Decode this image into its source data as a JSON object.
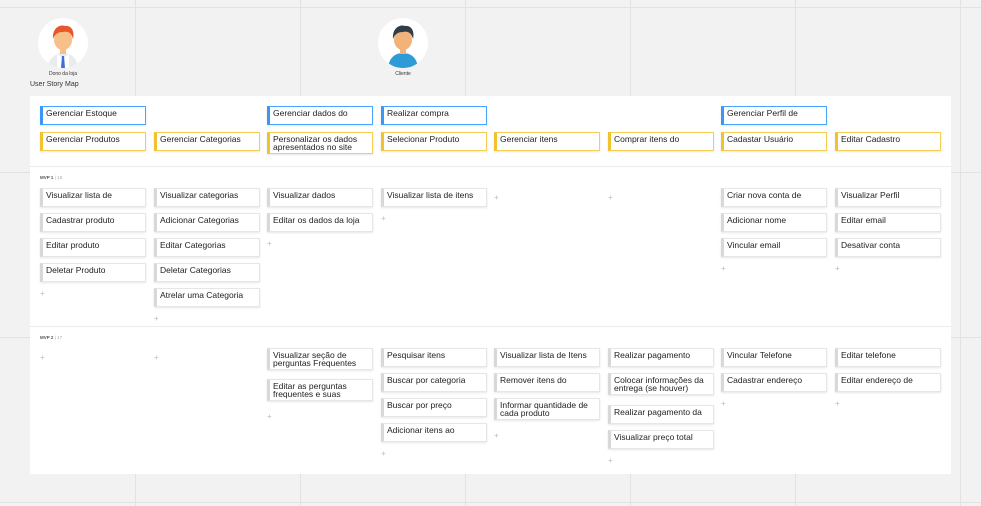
{
  "personas": [
    {
      "name": "Dono da loja"
    },
    {
      "name": "Cliente"
    }
  ],
  "board_title": "User Story Map",
  "goals": [
    "Gerenciar Estoque",
    "Gerenciar dados do",
    "Realizar compra",
    "Gerenciar Perfil de"
  ],
  "activities": [
    "Gerenciar Produtos",
    "Gerenciar Categorias",
    "Personalizar os dados apresentados no site",
    "Selecionar Produto",
    "Gerenciar itens",
    "Comprar itens do",
    "Cadastar Usuário",
    "Editar Cadastro"
  ],
  "releases": [
    {
      "name": "MVP 1",
      "count": "18",
      "columns": [
        [
          "Visualizar lista de",
          "Cadastrar produto",
          "Editar produto",
          "Deletar Produto"
        ],
        [
          "Visualizar categorias",
          "Adicionar Categorias",
          "Editar Categorias",
          "Deletar Categorias",
          "Atrelar uma Categoria"
        ],
        [
          "Visualizar dados",
          "Editar os dados da loja"
        ],
        [
          "Visualizar lista de itens"
        ],
        [],
        [],
        [
          "Criar nova conta de",
          "Adicionar nome",
          "Vincular email"
        ],
        [
          "Visualizar Perfil",
          "Editar email",
          "Desativar conta"
        ]
      ]
    },
    {
      "name": "MVP 2",
      "count": "17",
      "columns": [
        [],
        [],
        [
          "Visualizar seção de perguntas Frequentes",
          "Editar as perguntas frequentes e suas"
        ],
        [
          "Pesquisar itens",
          "Buscar por categoria",
          "Buscar por preço",
          "Adicionar itens ao"
        ],
        [
          "Visualizar lista de Itens",
          "Remover itens do",
          "Informar quantidade de cada produto"
        ],
        [
          "Realizar pagamento",
          "Colocar informações da entrega (se houver)",
          "Realizar pagamento da",
          "Visualizar preço total"
        ],
        [
          "Vincular Telefone",
          "Cadastrar endereço"
        ],
        [
          "Editar telefone",
          "Editar endereço de"
        ]
      ]
    }
  ],
  "add_symbol": "+",
  "colors": {
    "goal_accent": "#3b96f5",
    "activity_accent": "#f2c12e",
    "card_accent": "#d8d8d8"
  }
}
